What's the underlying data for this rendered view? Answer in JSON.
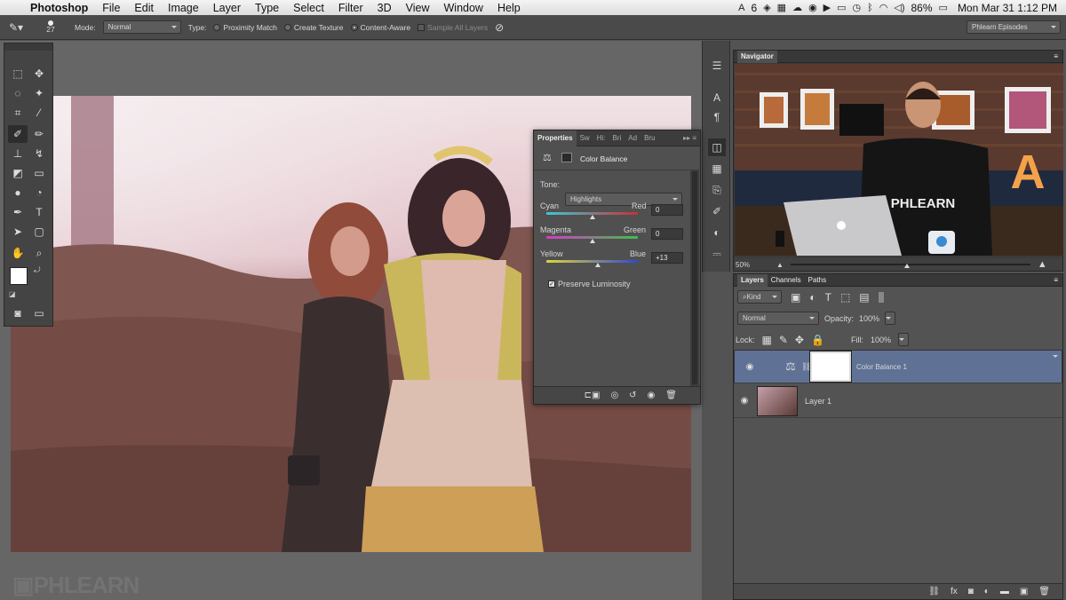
{
  "menubar": {
    "app": "Photoshop",
    "menus": [
      "File",
      "Edit",
      "Image",
      "Layer",
      "Type",
      "Select",
      "Filter",
      "3D",
      "View",
      "Window",
      "Help"
    ],
    "status": {
      "adobe_count": "6",
      "battery": "86%",
      "datetime": "Mon Mar 31  1:12 PM"
    }
  },
  "options": {
    "brush_size": "27",
    "mode_label": "Mode:",
    "mode_value": "Normal",
    "type_label": "Type:",
    "type_options": [
      "Proximity Match",
      "Create Texture",
      "Content-Aware"
    ],
    "type_selected": "Content-Aware",
    "sample_all": "Sample All Layers",
    "workspace": "Phlearn Episodes"
  },
  "properties": {
    "tabs": [
      "Properties",
      "Sw",
      "Hi:",
      "Bri",
      "Ad",
      "Bru"
    ],
    "title": "Color Balance",
    "tone_label": "Tone:",
    "tone_value": "Highlights",
    "sliders": [
      {
        "left": "Cyan",
        "right": "Red",
        "value": "0",
        "fraction": 0.5
      },
      {
        "left": "Magenta",
        "right": "Green",
        "value": "0",
        "fraction": 0.5
      },
      {
        "left": "Yellow",
        "right": "Blue",
        "value": "+13",
        "fraction": 0.565
      }
    ],
    "preserve_luminosity": "Preserve Luminosity",
    "preserve_checked": true
  },
  "navigator": {
    "title": "Navigator",
    "zoom": "50%",
    "shirt_text": "PHLEARN",
    "sign_letter": "A"
  },
  "layers": {
    "tabs": [
      "Layers",
      "Channels",
      "Paths"
    ],
    "filter_label": "Kind",
    "blend_mode": "Normal",
    "opacity_label": "Opacity:",
    "opacity_value": "100%",
    "lock_label": "Lock:",
    "fill_label": "Fill:",
    "fill_value": "100%",
    "items": [
      {
        "name": "Color Balance 1",
        "selected": true
      },
      {
        "name": "Layer 1",
        "selected": false
      }
    ]
  },
  "watermark": "PHLEARN",
  "colors": {
    "ui_bg": "#535353",
    "panel": "#505050",
    "selection": "#5f7295",
    "canvas_tint": "#c98a9a"
  }
}
